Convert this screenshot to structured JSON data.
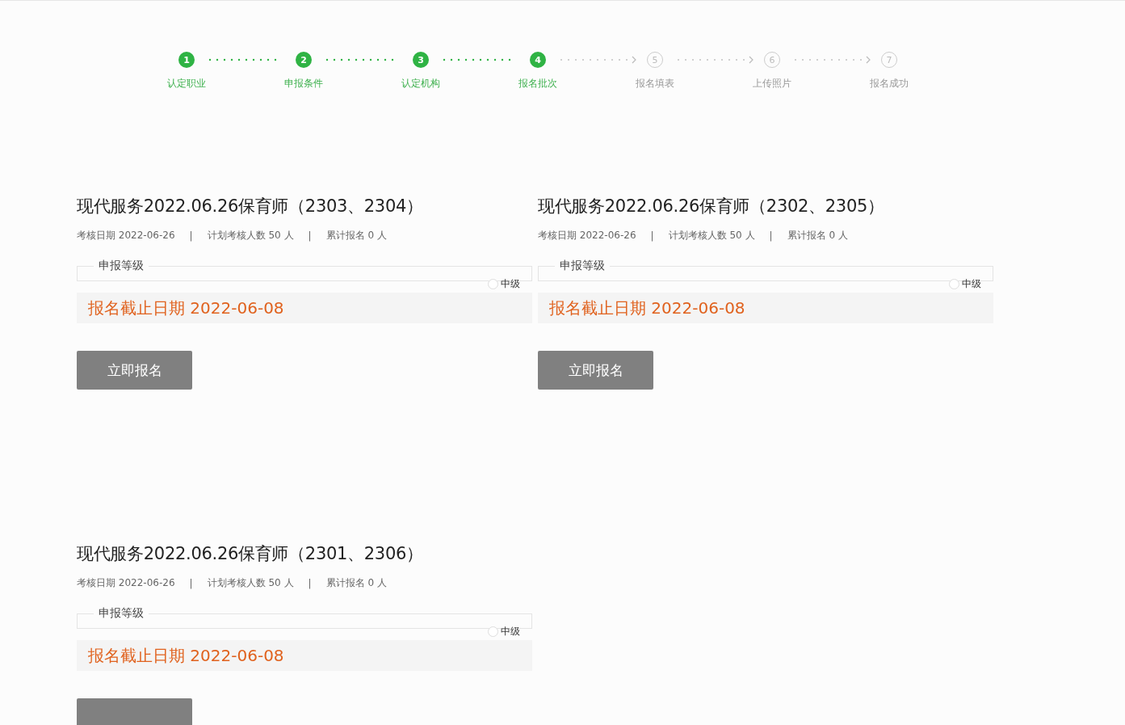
{
  "steps": [
    {
      "number": "1",
      "label": "认定职业",
      "done": true
    },
    {
      "number": "2",
      "label": "申报条件",
      "done": true
    },
    {
      "number": "3",
      "label": "认定机构",
      "done": true
    },
    {
      "number": "4",
      "label": "报名批次",
      "done": true
    },
    {
      "number": "5",
      "label": "报名填表",
      "done": false
    },
    {
      "number": "6",
      "label": "上传照片",
      "done": false
    },
    {
      "number": "7",
      "label": "报名成功",
      "done": false
    }
  ],
  "batches": [
    {
      "title": "现代服务2022.06.26保育师（2303、2304）",
      "meta": [
        "考核日期 2022-06-26",
        "|",
        "计划考核人数 50 人",
        "|",
        "累计报名 0 人"
      ],
      "level_legend": "申报等级",
      "levels": [
        {
          "label": "中级",
          "selected": false
        }
      ],
      "deadline": "报名截止日期 2022-06-08",
      "button": "立即报名"
    },
    {
      "title": "现代服务2022.06.26保育师（2302、2305）",
      "meta": [
        "考核日期 2022-06-26",
        "|",
        "计划考核人数 50 人",
        "|",
        "累计报名 0 人"
      ],
      "level_legend": "申报等级",
      "levels": [
        {
          "label": "中级",
          "selected": false
        }
      ],
      "deadline": "报名截止日期 2022-06-08",
      "button": "立即报名"
    },
    {
      "title": "现代服务2022.06.26保育师（2301、2306）",
      "meta": [
        "考核日期 2022-06-26",
        "|",
        "计划考核人数 50 人",
        "|",
        "累计报名 0 人"
      ],
      "level_legend": "申报等级",
      "levels": [
        {
          "label": "中级",
          "selected": false
        }
      ],
      "deadline": "报名截止日期 2022-06-08"
    }
  ]
}
